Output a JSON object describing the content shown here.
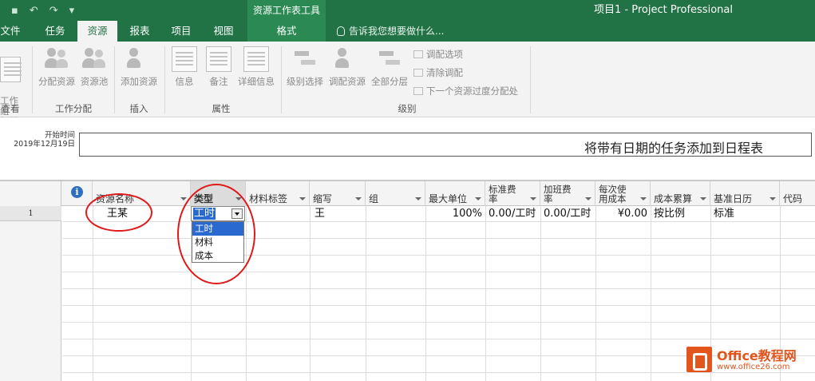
{
  "window": {
    "context_title": "资源工作表工具",
    "app_title": "项目1 - Project Professional"
  },
  "tabs": [
    {
      "label": "文件"
    },
    {
      "label": "任务"
    },
    {
      "label": "资源"
    },
    {
      "label": "报表"
    },
    {
      "label": "项目"
    },
    {
      "label": "视图"
    },
    {
      "label": "格式"
    }
  ],
  "tell_me": "告诉我您想要做什么...",
  "ribbon": {
    "team_planner": "工作组\n划器",
    "assign_resources": "分配资源",
    "resource_pool": "资源池",
    "add_resource": "添加资源",
    "information": "信息",
    "notes": "备注",
    "details": "详细信息",
    "level_selection": "级别选择",
    "level_resource": "调配资源",
    "level_all": "全部分层",
    "leveling_options": "调配选项",
    "clear_leveling": "清除调配",
    "next_overallocation": "下一个资源过度分配处",
    "groups": {
      "view": "查看",
      "assignments": "工作分配",
      "insert": "插入",
      "properties": "属性",
      "level": "级别"
    }
  },
  "timeline": {
    "start_label": "开始时间",
    "start_date": "2019年12月19日",
    "placeholder": "将带有日期的任务添加到日程表"
  },
  "columns": {
    "name": "资源名称",
    "type": "类型",
    "material_label": "材料标签",
    "initials": "缩写",
    "group": "组",
    "max_units": "最大单位",
    "std_rate_1": "标准费",
    "std_rate_2": "率",
    "ovt_rate_1": "加班费",
    "ovt_rate_2": "率",
    "cost_use_1": "每次使",
    "cost_use_2": "用成本",
    "accrue": "成本累算",
    "base_calendar": "基准日历",
    "code": "代码"
  },
  "row": {
    "id": "1",
    "name": "王某",
    "type": "工时",
    "initials": "王",
    "max_units": "100%",
    "std_rate": "0.00/工时",
    "ovt_rate": "0.00/工时",
    "cost_use": "¥0.00",
    "accrue": "按比例",
    "base_calendar": "标准"
  },
  "type_options": [
    "工时",
    "材料",
    "成本"
  ],
  "watermark": {
    "brand": "Office教程网",
    "url": "www.office26.com"
  },
  "colors": {
    "accent": "#217346",
    "selection": "#2a6ad0",
    "annotation": "#e01818"
  }
}
